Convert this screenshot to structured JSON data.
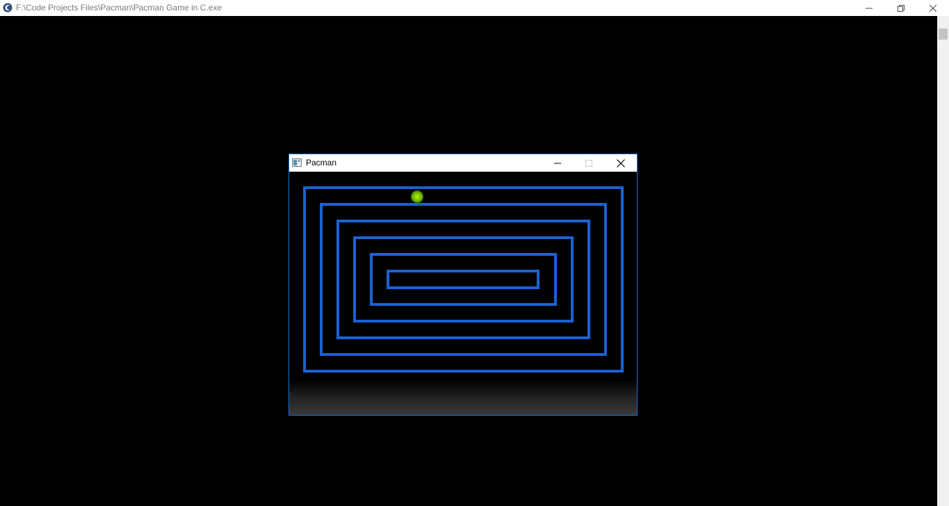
{
  "console": {
    "title": "F:\\Code Projects Files\\Pacman\\Pacman Game in C.exe",
    "controls": [
      "minimize-icon",
      "restore-icon",
      "close-icon"
    ]
  },
  "game": {
    "title": "Pacman",
    "controls": [
      "minimize-icon",
      "maximize-icon",
      "close-icon"
    ]
  },
  "colors": {
    "maze": "#1a62d2",
    "pacman": "#7cc400",
    "window_border": "#1e73d6"
  }
}
